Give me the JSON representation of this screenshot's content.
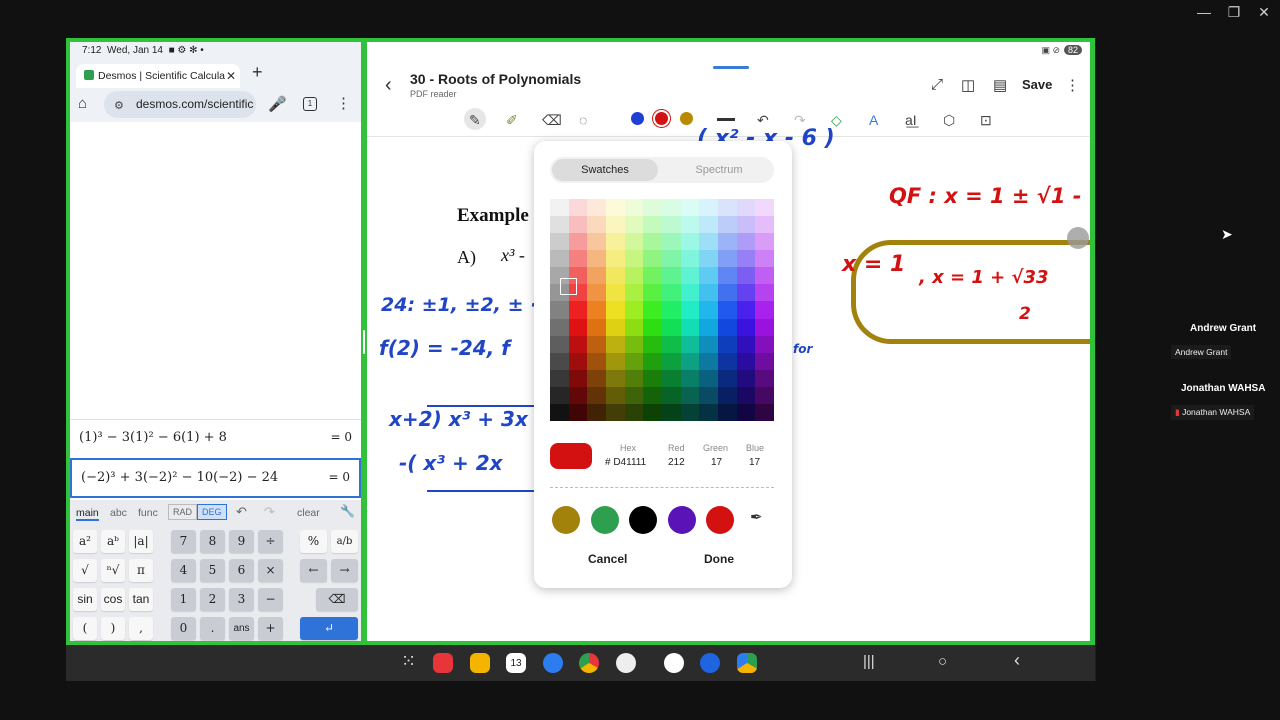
{
  "window_controls": {
    "minimize": "—",
    "restore": "❐",
    "close": "✕"
  },
  "android_status_left": {
    "time": "7:12",
    "date": "Wed, Jan 14",
    "icons": "■ ⚙ ✻ •"
  },
  "android_status_right": {
    "icons": "▣ ⊘",
    "battery": "82"
  },
  "browser": {
    "tab_title": "Desmos | Scientific Calcula",
    "close": "✕",
    "new_tab": "+",
    "url": "desmos.com/scientific",
    "tabs_count": "1",
    "menu": "⋮",
    "home": "⌂",
    "mic": "🎤"
  },
  "desmos": {
    "expressions": [
      {
        "text": "(1)³ − 3(1)² − 6(1) + 8",
        "result": "= 0"
      },
      {
        "text": "(−2)³ + 3(−2)² − 10(−2) − 24",
        "result": "= 0"
      }
    ],
    "keyboard_tabs": {
      "main": "main",
      "abc": "abc",
      "func": "func",
      "rad": "RAD",
      "deg": "DEG",
      "undo": "↶",
      "redo": "↷",
      "clear": "clear",
      "wrench": "🔧"
    },
    "keys": {
      "a2": "a²",
      "ab": "aᵇ",
      "abs": "|a|",
      "sqrt": "√",
      "nroot": "ⁿ√",
      "pi": "π",
      "sin": "sin",
      "cos": "cos",
      "tan": "tan",
      "lparen": "(",
      "rparen": ")",
      "comma": ",",
      "k7": "7",
      "k8": "8",
      "k9": "9",
      "div": "÷",
      "k4": "4",
      "k5": "5",
      "k6": "6",
      "mul": "×",
      "k1": "1",
      "k2": "2",
      "k3": "3",
      "minus": "−",
      "k0": "0",
      "dot": ".",
      "ans": "ans",
      "plus": "+",
      "percent": "%",
      "frac": "a/b",
      "left": "←",
      "right": "→",
      "backspace": "⌫",
      "enter": "↵"
    }
  },
  "notes": {
    "title": "30 - Roots of Polynomials",
    "subtitle": "PDF reader",
    "back": "‹",
    "save": "Save",
    "more": "⋮",
    "top_icons": {
      "expand": "⤢",
      "split": "◫",
      "pages": "▤"
    },
    "tools": {
      "pen": "✎",
      "highlighter": "✐",
      "eraser": "⌫",
      "lasso": "◌",
      "undo": "↶",
      "redo": "↷",
      "shapes": "◇",
      "text": "A",
      "textbox": "a͟I",
      "shape": "⬡",
      "more": "⊡"
    },
    "tool_colors": [
      "#1d3fd6",
      "#d41111",
      "#b88a00"
    ],
    "page": {
      "example": "Example",
      "part_a": "A)",
      "part_a_expr": "x³ -",
      "ink_1": "24: ±1, ±2, ± ·",
      "ink_2": "f(2) = -24, f",
      "ink_3": "x+2) x³ + 3x",
      "ink_4": "-( x³ + 2x",
      "ink_top": "( x² - x - 6 )",
      "ink_qf": "QF : x = 1 ± √1 -",
      "ink_x1": "x = 1",
      "ink_x2": ", x = 1 + √33",
      "ink_x2_den": "2",
      "ink_for": "for"
    },
    "picker": {
      "tab_swatches": "Swatches",
      "tab_spectrum": "Spectrum",
      "hex_label": "Hex",
      "red_label": "Red",
      "green_label": "Green",
      "blue_label": "Blue",
      "hex_value": "# D41111",
      "red_value": "212",
      "green_value": "17",
      "blue_value": "17",
      "current_color": "#d41111",
      "preset_colors": [
        "#a3820b",
        "#2e9e4f",
        "#000000",
        "#5a13b7",
        "#d41111"
      ],
      "eyedropper": "✒",
      "cancel": "Cancel",
      "done": "Done"
    }
  },
  "nav": {
    "apps": "⁙",
    "calendar_day": "13",
    "recents": "|||",
    "home": "○",
    "back": "‹"
  },
  "participants": [
    {
      "name": "Andrew Grant",
      "tag": "Andrew Grant"
    },
    {
      "name": "Jonathan WAHSA",
      "tag": "Jonathan WAHSA"
    }
  ]
}
